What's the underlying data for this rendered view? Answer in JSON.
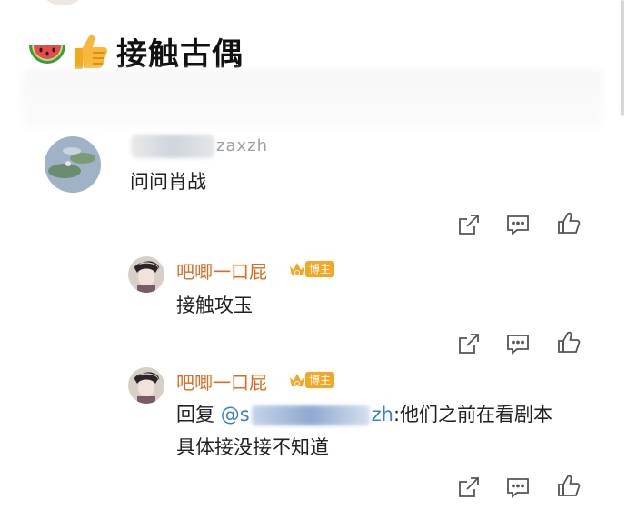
{
  "post": {
    "title_emoji_1": "watermelon-icon",
    "title_emoji_2": "thumbs-up-icon",
    "title": "接触古偶"
  },
  "comments": [
    {
      "handle_tail": "zaxzh",
      "text": "问问肖战",
      "actions": [
        "share-icon",
        "comment-icon",
        "like-icon"
      ]
    }
  ],
  "replies": [
    {
      "username": "吧唧一口屁",
      "badge": "博主",
      "text": "接触攻玉",
      "actions": [
        "share-icon",
        "comment-icon",
        "like-icon"
      ]
    },
    {
      "username": "吧唧一口屁",
      "badge": "博主",
      "reply_prefix": "回复",
      "mention_at": "@s",
      "mention_tail": "zh",
      "text_line1": ":他们之前在看剧本",
      "text_line2": "具体接没接不知道",
      "actions": [
        "share-icon",
        "comment-icon",
        "like-icon"
      ]
    }
  ],
  "colors": {
    "username": "#e06a1f",
    "badge": "#f5a623",
    "mention": "#3b7fd0",
    "icon": "#555555"
  }
}
